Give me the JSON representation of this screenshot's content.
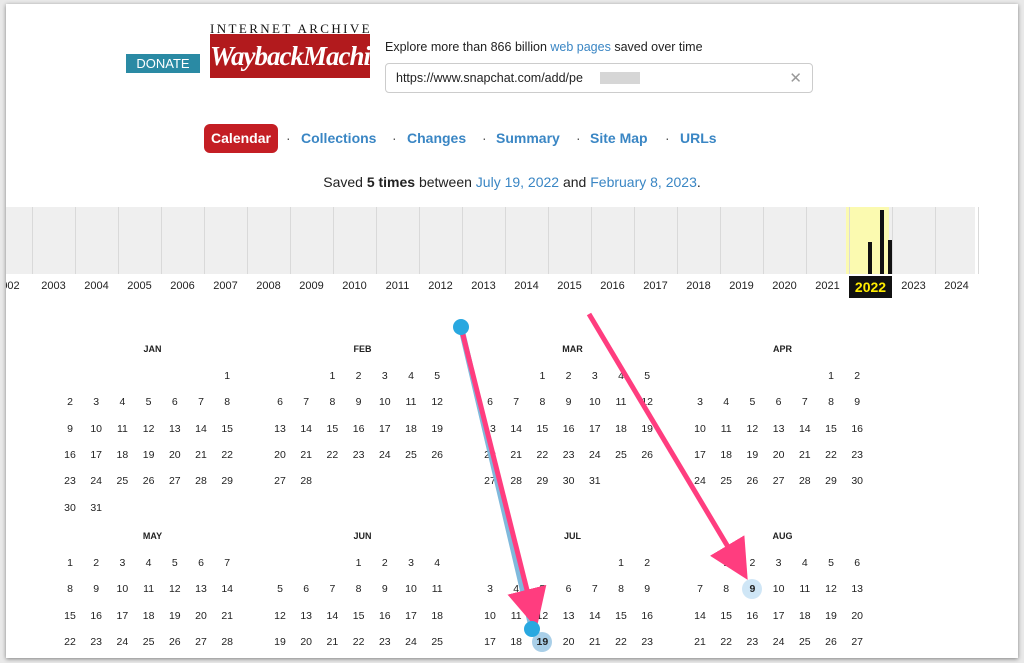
{
  "header": {
    "donate_label": "DONATE",
    "logo_top": "INTERNET ARCHIVE",
    "logo_main": "WaybackMachine",
    "tagline_prefix": "Explore more than 866 billion ",
    "tagline_link": "web pages",
    "tagline_suffix": " saved over time"
  },
  "search": {
    "value": "https://www.snapchat.com/add/pe",
    "clear_icon": "close-icon"
  },
  "nav": {
    "tabs": [
      {
        "label": "Calendar",
        "active": true
      },
      {
        "label": "Collections"
      },
      {
        "label": "Changes"
      },
      {
        "label": "Summary"
      },
      {
        "label": "Site Map"
      },
      {
        "label": "URLs"
      }
    ],
    "separator": "·"
  },
  "summary": {
    "prefix": "Saved ",
    "count": "5 times",
    "middle": " between ",
    "start": "July 19, 2022",
    "and": " and ",
    "end": "February 8, 2023",
    "suffix": "."
  },
  "timeline": {
    "years": [
      "002",
      "2003",
      "2004",
      "2005",
      "2006",
      "2007",
      "2008",
      "2009",
      "2010",
      "2011",
      "2012",
      "2013",
      "2014",
      "2015",
      "2016",
      "2017",
      "2018",
      "2019",
      "2020",
      "2021",
      "2022",
      "2023",
      "2024"
    ],
    "selected": "2022",
    "accent_color": "#fbfab0"
  },
  "calendar": {
    "months": [
      {
        "name": "JAN",
        "start": 6,
        "days": 31
      },
      {
        "name": "FEB",
        "start": 2,
        "days": 28
      },
      {
        "name": "MAR",
        "start": 2,
        "days": 31
      },
      {
        "name": "APR",
        "start": 5,
        "days": 30
      },
      {
        "name": "MAY",
        "start": 0,
        "days": 28
      },
      {
        "name": "JUN",
        "start": 3,
        "days": 28
      },
      {
        "name": "JUL",
        "start": 5,
        "days": 23
      },
      {
        "name": "AUG",
        "start": 1,
        "days": 27
      }
    ],
    "snapshots": [
      {
        "month": "JUL",
        "day": 19
      },
      {
        "month": "AUG",
        "day": 9
      }
    ]
  },
  "colors": {
    "brand_red": "#c41e24",
    "link_blue": "#3a86c4",
    "annotation_pink": "#ff3d7f",
    "annotation_dot": "#29a8e0"
  }
}
